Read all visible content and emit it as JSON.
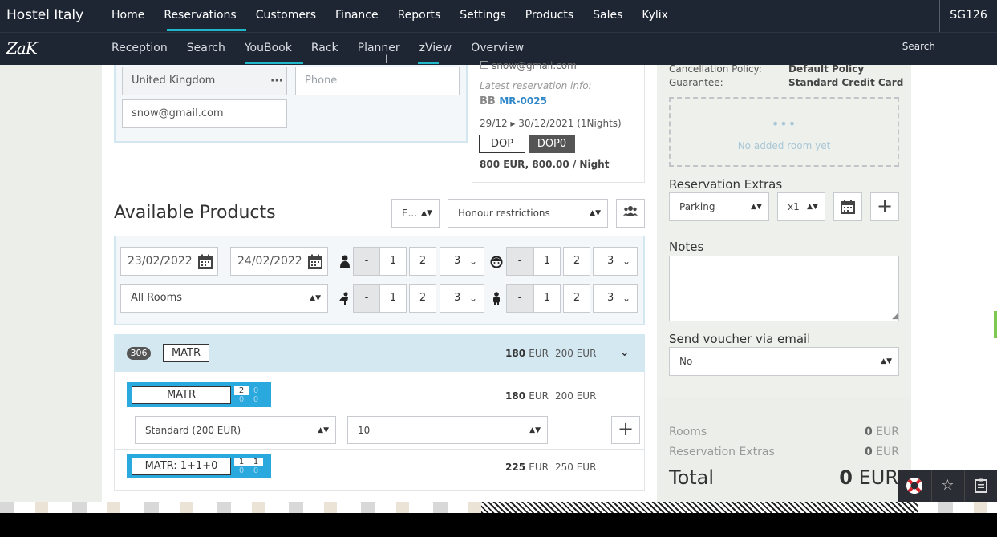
{
  "top_nav": {
    "brand": "Hostel Italy",
    "items": [
      "Home",
      "Reservations",
      "Customers",
      "Finance",
      "Reports",
      "Settings",
      "Products",
      "Sales",
      "Kylix"
    ],
    "user_code": "SG126"
  },
  "sub_nav": {
    "logo": "ZaK",
    "items": [
      "Reception",
      "Search",
      "YouBook",
      "Rack",
      "Planner",
      "zView",
      "Overview"
    ],
    "search": "Search"
  },
  "guest_form": {
    "country": "United Kingdom",
    "phone_placeholder": "Phone",
    "email": "snow@gmail.com"
  },
  "latest_reservation": {
    "email": "snow@gmail.com",
    "label": "Latest reservation info:",
    "board": "BB",
    "code": "MR-0025",
    "dates": "29/12 ▸ 30/12/2021 (1Nights)",
    "tags": [
      "DOP",
      "DOP0"
    ],
    "price": "800 EUR, 800.00 / Night"
  },
  "available_products": {
    "title": "Available Products",
    "lang_select": "E...",
    "restriction_select": "Honour restrictions",
    "date_from": "23/02/2022",
    "date_to": "24/02/2022",
    "room_filter": "All Rooms",
    "counters": {
      "minus": "-",
      "one": "1",
      "two": "2",
      "three": "3"
    }
  },
  "room_group": {
    "count": "306",
    "code": "MATR",
    "price": "180",
    "price_unit": "EUR",
    "base_price": "200 EUR",
    "rates": [
      {
        "code": "MATR",
        "grid": [
          "2",
          "0",
          "0",
          "0"
        ],
        "price": "180",
        "price_unit": "EUR",
        "base_price": "200 EUR",
        "rate_plan": "Standard (200 EUR)",
        "quantity": "10"
      },
      {
        "code": "MATR: 1+1+0",
        "grid": [
          "1",
          "1",
          "0",
          "0"
        ],
        "price": "225",
        "price_unit": "EUR",
        "base_price": "250 EUR"
      }
    ]
  },
  "policy": {
    "cancellation_label": "Cancellation Policy:",
    "cancellation_value": "Default Policy",
    "guarantee_label": "Guarantee:",
    "guarantee_value": "Standard Credit Card"
  },
  "rooms_box": {
    "dots": "•••",
    "empty_text": "No added room yet"
  },
  "extras": {
    "title": "Reservation Extras",
    "item": "Parking",
    "qty": "x1"
  },
  "notes": {
    "title": "Notes"
  },
  "voucher": {
    "title": "Send voucher via email",
    "value": "No"
  },
  "totals": {
    "rooms_label": "Rooms",
    "rooms_value": "0",
    "extras_label": "Reservation Extras",
    "extras_value": "0",
    "currency": "EUR",
    "total_label": "Total",
    "total_value": "0",
    "total_currency": "EUR"
  },
  "colors": {
    "nav_bg": "#1f2633",
    "accent": "#1fb7c9",
    "rate_blue": "#2aa9df",
    "link_blue": "#2f86c9"
  }
}
